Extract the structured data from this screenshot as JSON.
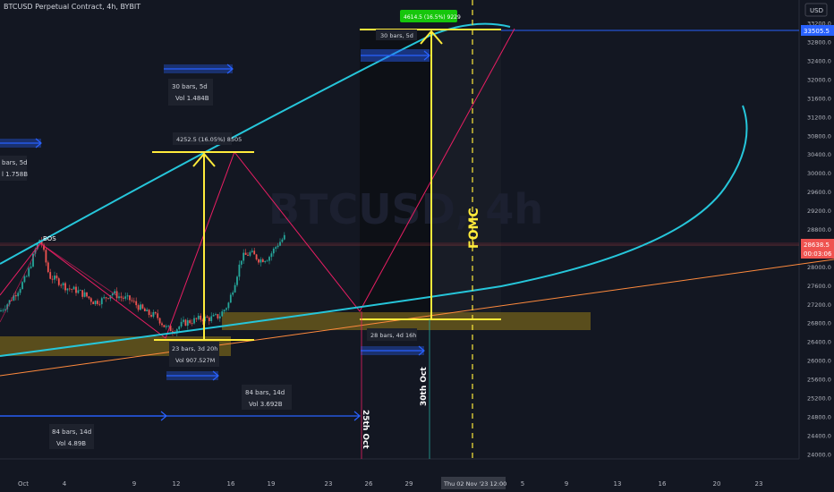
{
  "header": {
    "title": "BTCUSD Perpetual Contract, 4h, BYBIT",
    "currency": "USD"
  },
  "colors": {
    "background": "#131722",
    "up_candle": "#26a69a",
    "down_candle": "#ef5350",
    "yellow": "#ffeb3b",
    "cyan": "#26c6da",
    "pink": "#e91e63",
    "orange": "#ff8a3d",
    "blue": "#2962ff",
    "green_badge": "#16c60c"
  },
  "chart_data": {
    "type": "candlestick",
    "symbol": "BTCUSD",
    "interval": "4h",
    "price_scale_ticks": [
      24000,
      24400,
      24800,
      25200,
      25600,
      26000,
      26400,
      26800,
      27200,
      27600,
      28000,
      28400,
      28800,
      29200,
      29600,
      30000,
      30400,
      30800,
      31200,
      31600,
      32000,
      32400,
      32800,
      33200,
      33600
    ],
    "price_scale_labels": [
      "24000.0",
      "24400.0",
      "24800.0",
      "25200.0",
      "25600.0",
      "26000.0",
      "26400.0",
      "26800.0",
      "27200.0",
      "27600.0",
      "28000.0",
      "28400.0",
      "28800.0",
      "29200.0",
      "29600.0",
      "30000.0",
      "30400.0",
      "30800.0",
      "31200.0",
      "31600.0",
      "32000.0",
      "32400.0",
      "32800.0",
      "33200.0",
      "33600.0"
    ],
    "ylim": [
      23900,
      33700
    ],
    "time_labels": [
      "Oct",
      "4",
      "9",
      "12",
      "16",
      "19",
      "23",
      "26",
      "29",
      "5",
      "9",
      "13",
      "16",
      "20",
      "23"
    ],
    "crosshair_time_label": "Thu 02 Nov '23  12:00",
    "current_price": {
      "value": 28638.5,
      "label": "28638.5",
      "countdown": "00:03:06"
    },
    "target_price": {
      "value": 33505.5,
      "label": "33505.5"
    },
    "close_trend": [
      [
        0,
        27050
      ],
      [
        10,
        27250
      ],
      [
        20,
        27500
      ],
      [
        30,
        27800
      ],
      [
        40,
        28400
      ],
      [
        45,
        28620
      ],
      [
        55,
        27800
      ],
      [
        65,
        27700
      ],
      [
        75,
        27550
      ],
      [
        85,
        27500
      ],
      [
        95,
        27400
      ],
      [
        105,
        27250
      ],
      [
        115,
        27300
      ],
      [
        125,
        27450
      ],
      [
        135,
        27350
      ],
      [
        145,
        27300
      ],
      [
        155,
        27150
      ],
      [
        165,
        27000
      ],
      [
        175,
        26950
      ],
      [
        185,
        26700
      ],
      [
        195,
        26650
      ],
      [
        205,
        26800
      ],
      [
        215,
        26850
      ],
      [
        225,
        26900
      ],
      [
        235,
        26900
      ],
      [
        245,
        26950
      ],
      [
        255,
        27200
      ],
      [
        262,
        27650
      ],
      [
        270,
        28200
      ],
      [
        280,
        28300
      ],
      [
        290,
        28150
      ],
      [
        300,
        28200
      ],
      [
        310,
        28480
      ],
      [
        318,
        28638.5
      ]
    ],
    "annotations": {
      "bos": "BOS",
      "range_top": "4252.5 (16.05%) 8505",
      "range_bottom": "23 bars, 3d 20h",
      "vol_bottom": "Vol 907.527M",
      "bars_top_left": "bars, 5d",
      "vol_top_left": "l 1.758B",
      "bars_top_mid": "30 bars, 5d",
      "vol_top_mid": "Vol 1.484B",
      "bars_right_mid": "84 bars, 14d",
      "vol_right_mid": "Vol 3.692B",
      "bars_bottom_left": "84 bars, 14d",
      "vol_bottom_left": "Vol 4.89B",
      "bars_projection": "28 bars, 4d 16h",
      "bars_projection_top": "30 bars, 5d",
      "green_badge": "4614.5 (16.5%) 9229",
      "fomc": "FOMC",
      "date_25": "25th Oct",
      "date_30": "30th Oct"
    }
  }
}
